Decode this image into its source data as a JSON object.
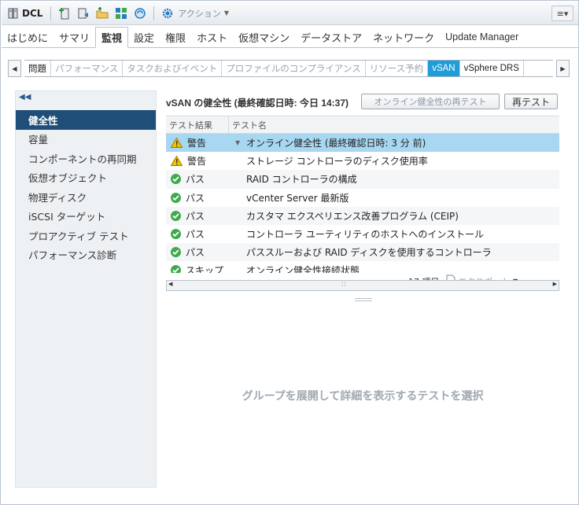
{
  "toolbar": {
    "object_name": "DCL",
    "actions_label": "アクション"
  },
  "tabs": [
    {
      "label": "はじめに"
    },
    {
      "label": "サマリ"
    },
    {
      "label": "監視"
    },
    {
      "label": "設定"
    },
    {
      "label": "権限"
    },
    {
      "label": "ホスト"
    },
    {
      "label": "仮想マシン"
    },
    {
      "label": "データストア"
    },
    {
      "label": "ネットワーク"
    },
    {
      "label": "Update Manager"
    }
  ],
  "subtabs": [
    {
      "label": "問題"
    },
    {
      "label": "パフォーマンス"
    },
    {
      "label": "タスクおよびイベント"
    },
    {
      "label": "プロファイルのコンプライアンス"
    },
    {
      "label": "リソース予約"
    },
    {
      "label": "vSAN"
    },
    {
      "label": "vSphere DRS"
    }
  ],
  "nav": {
    "items": [
      {
        "label": "健全性"
      },
      {
        "label": "容量"
      },
      {
        "label": "コンポーネントの再同期"
      },
      {
        "label": "仮想オブジェクト"
      },
      {
        "label": "物理ディスク"
      },
      {
        "label": "iSCSI ターゲット"
      },
      {
        "label": "プロアクティブ テスト"
      },
      {
        "label": "パフォーマンス診断"
      }
    ]
  },
  "panel": {
    "title": "vSAN の健全性 (最終確認日時: 今日 14:37)",
    "retest_online_label": "オンライン健全性の再テスト",
    "retest_label": "再テスト",
    "col_result": "テスト結果",
    "col_name": "テスト名",
    "rows": [
      {
        "status": "警告",
        "icon": "warning",
        "name": "オンライン健全性 (最終確認日時: 3 分 前)",
        "expandable": true
      },
      {
        "status": "警告",
        "icon": "warning",
        "name": "ストレージ コントローラのディスク使用率"
      },
      {
        "status": "パス",
        "icon": "ok",
        "name": "RAID コントローラの構成"
      },
      {
        "status": "パス",
        "icon": "ok",
        "name": "vCenter Server 最新版"
      },
      {
        "status": "パス",
        "icon": "ok",
        "name": "カスタマ エクスペリエンス改善プログラム (CEIP)"
      },
      {
        "status": "パス",
        "icon": "ok",
        "name": "コントローラ ユーティリティのホストへのインストール"
      },
      {
        "status": "パス",
        "icon": "ok",
        "name": "パススルーおよび RAID ディスクを使用するコントローラ"
      },
      {
        "status": "スキップ",
        "icon": "ok",
        "name": "オンライン健全性接続状態"
      }
    ],
    "item_count": "17 項目",
    "export_label": "エクスポート",
    "detail_message": "グループを展開して詳細を表示するテストを選択"
  },
  "colors": {
    "accent": "#1f9dd9",
    "nav_active": "#1f4e79",
    "selected_row": "#a8d7f2",
    "ok": "#3eaa4c",
    "warning": "#f2c200"
  }
}
